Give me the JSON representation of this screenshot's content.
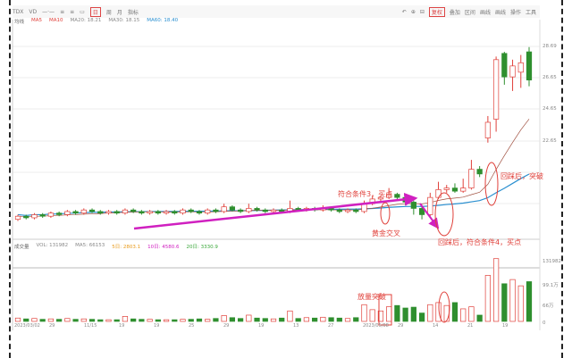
{
  "toolbar": {
    "left": [
      "TDX",
      "VD",
      "—·—",
      "≡",
      "≡",
      "▭",
      "日",
      "周",
      "月",
      "指标"
    ],
    "selected": "日",
    "right": [
      "↶",
      "⊕",
      "⊟",
      "复权",
      "叠加",
      "区间",
      "画线",
      "画线",
      "操作",
      "工具"
    ],
    "right_selected": "复权"
  },
  "legend": {
    "title": "均线",
    "items": [
      {
        "label": "MA5",
        "color": "#e0403a"
      },
      {
        "label": "MA10",
        "color": "#e0403a"
      },
      {
        "label": "MA20: 18.21",
        "color": "#888888"
      },
      {
        "label": "MA30: 18.15",
        "color": "#888888"
      },
      {
        "label": "MA60: 18.40",
        "color": "#2a8fd0"
      }
    ]
  },
  "volume_legend": {
    "title": "成交量",
    "items": [
      {
        "label": "VOL: 131982",
        "color": "#888888"
      },
      {
        "label": "MA5: 66153",
        "color": "#888888"
      },
      {
        "label": "5日: 2803.1",
        "color": "#e89a1a"
      },
      {
        "label": "10日: 4580.6",
        "color": "#d020c0"
      },
      {
        "label": "20日: 3330.9",
        "color": "#3aa83a"
      }
    ]
  },
  "price_axis": [
    "28.69",
    "26.65",
    "24.65",
    "22.65"
  ],
  "volume_axis": [
    "131982",
    "99.1万",
    "66万",
    "0"
  ],
  "date_labels": [
    "2023/03/02",
    "29",
    "11/15",
    "19",
    "19",
    "25",
    "29",
    "19",
    "13",
    "27",
    "2023/05/08",
    "29",
    "14",
    "21",
    "19"
  ],
  "annotations": {
    "buy3": "符合条件3，买点",
    "golden_cross": "黄金交叉",
    "pullback_buy4": "回踩后，符合条件4，买点",
    "pullback_breakout": "回踩后，突破",
    "volume_breakout": "放量突破"
  },
  "colors": {
    "up": "#e0403a",
    "down": "#2f8f2f",
    "ma_long": "#2a8fd0",
    "ma_short": "#a05040",
    "arrow": "#d020c0"
  },
  "chart_data": {
    "type": "candlestick",
    "ylim": [
      16.5,
      29.9
    ],
    "volume_ylim": [
      0,
      160
    ],
    "candles_ocHLv": [
      [
        17.6,
        17.8,
        17.9,
        17.5,
        8
      ],
      [
        17.8,
        17.7,
        17.9,
        17.6,
        6
      ],
      [
        17.7,
        17.9,
        18.0,
        17.6,
        7
      ],
      [
        17.9,
        17.8,
        18.0,
        17.7,
        5
      ],
      [
        17.8,
        18.0,
        18.1,
        17.7,
        6
      ],
      [
        18.0,
        17.9,
        18.1,
        17.8,
        5
      ],
      [
        17.9,
        18.1,
        18.2,
        17.8,
        7
      ],
      [
        18.1,
        18.0,
        18.2,
        17.9,
        5
      ],
      [
        18.0,
        18.2,
        18.3,
        17.9,
        6
      ],
      [
        18.2,
        18.1,
        18.3,
        18.0,
        5
      ],
      [
        18.1,
        18.0,
        18.2,
        17.9,
        4
      ],
      [
        18.0,
        18.1,
        18.2,
        17.9,
        4
      ],
      [
        18.1,
        18.0,
        18.2,
        17.9,
        4
      ],
      [
        18.0,
        18.2,
        18.3,
        17.9,
        12
      ],
      [
        18.2,
        18.1,
        18.3,
        18.0,
        6
      ],
      [
        18.1,
        18.0,
        18.2,
        17.9,
        5
      ],
      [
        18.0,
        18.1,
        18.2,
        17.9,
        5
      ],
      [
        18.1,
        18.0,
        18.2,
        17.9,
        4
      ],
      [
        18.0,
        18.1,
        18.2,
        17.9,
        4
      ],
      [
        18.1,
        18.0,
        18.2,
        17.9,
        4
      ],
      [
        18.0,
        18.2,
        18.3,
        17.9,
        5
      ],
      [
        18.2,
        18.1,
        18.3,
        18.0,
        5
      ],
      [
        18.1,
        18.0,
        18.2,
        17.9,
        6
      ],
      [
        18.0,
        18.2,
        18.3,
        17.9,
        5
      ],
      [
        18.2,
        18.1,
        18.3,
        18.0,
        7
      ],
      [
        18.1,
        18.4,
        18.6,
        18.0,
        14
      ],
      [
        18.4,
        18.2,
        18.5,
        18.1,
        9
      ],
      [
        18.2,
        18.1,
        18.3,
        18.0,
        7
      ],
      [
        18.1,
        18.3,
        18.6,
        18.0,
        15
      ],
      [
        18.3,
        18.2,
        18.4,
        18.1,
        8
      ],
      [
        18.2,
        18.1,
        18.3,
        18.0,
        7
      ],
      [
        18.1,
        18.2,
        18.3,
        18.0,
        6
      ],
      [
        18.2,
        18.1,
        18.3,
        18.0,
        8
      ],
      [
        18.1,
        18.3,
        18.8,
        18.0,
        25
      ],
      [
        18.3,
        18.2,
        18.4,
        18.1,
        7
      ],
      [
        18.2,
        18.3,
        18.4,
        18.1,
        9
      ],
      [
        18.3,
        18.2,
        18.4,
        18.1,
        8
      ],
      [
        18.2,
        18.3,
        18.5,
        18.1,
        10
      ],
      [
        18.3,
        18.2,
        18.4,
        18.1,
        9
      ],
      [
        18.2,
        18.1,
        18.3,
        18.0,
        8
      ],
      [
        18.1,
        18.2,
        18.3,
        18.0,
        7
      ],
      [
        18.2,
        18.1,
        18.3,
        18.0,
        9
      ],
      [
        18.1,
        18.6,
        18.8,
        18.0,
        40
      ],
      [
        18.6,
        18.9,
        19.1,
        18.5,
        28
      ],
      [
        18.9,
        19.0,
        19.1,
        18.7,
        25
      ],
      [
        19.0,
        19.2,
        19.6,
        18.9,
        35
      ],
      [
        19.2,
        19.0,
        19.3,
        18.8,
        38
      ],
      [
        19.0,
        18.7,
        19.1,
        18.5,
        32
      ],
      [
        18.7,
        18.3,
        18.8,
        17.9,
        34
      ],
      [
        18.3,
        17.9,
        18.4,
        17.6,
        20
      ],
      [
        17.9,
        19.0,
        19.3,
        17.8,
        40
      ],
      [
        19.0,
        19.5,
        20.0,
        18.9,
        45
      ],
      [
        19.5,
        19.6,
        19.8,
        19.3,
        38
      ],
      [
        19.6,
        19.4,
        19.9,
        19.3,
        45
      ],
      [
        19.4,
        19.6,
        20.2,
        19.3,
        30
      ],
      [
        19.6,
        20.8,
        21.4,
        19.5,
        35
      ],
      [
        20.8,
        20.5,
        21.0,
        20.3,
        15
      ],
      [
        22.8,
        23.8,
        24.2,
        22.5,
        110
      ],
      [
        24.0,
        27.8,
        28.0,
        23.2,
        150
      ],
      [
        28.2,
        26.7,
        28.3,
        26.2,
        90
      ],
      [
        26.7,
        27.4,
        27.8,
        25.8,
        100
      ],
      [
        27.0,
        27.6,
        28.1,
        26.0,
        85
      ],
      [
        28.3,
        26.5,
        28.6,
        26.1,
        95
      ]
    ]
  }
}
